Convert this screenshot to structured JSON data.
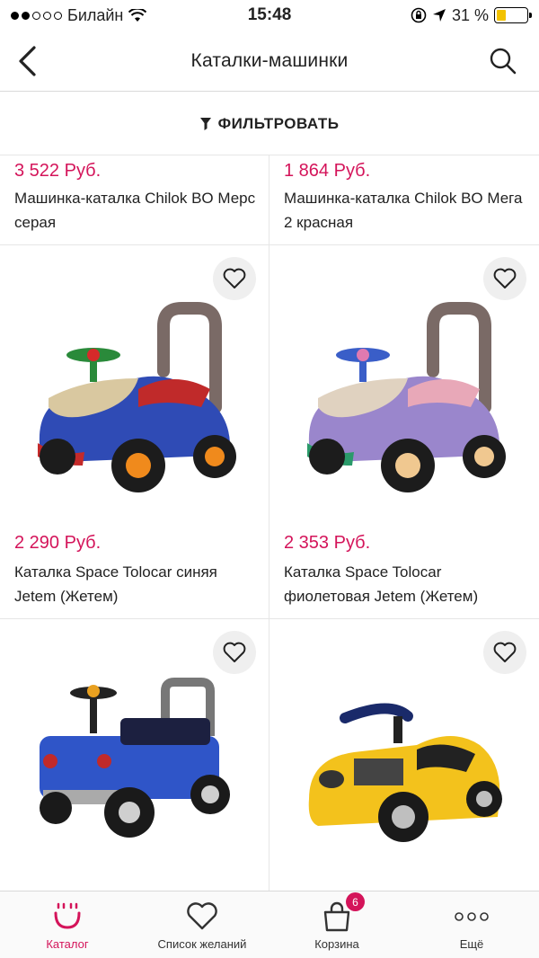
{
  "status_bar": {
    "carrier": "Билайн",
    "time": "15:48",
    "battery_percent": "31 %",
    "battery_level": 0.31
  },
  "nav": {
    "title": "Каталки-машинки",
    "back_icon": "chevron-left-icon",
    "search_icon": "search-icon"
  },
  "filter": {
    "label": "ФИЛЬТРОВАТЬ",
    "icon": "filter-funnel-icon"
  },
  "products": [
    {
      "price": "3 522 Руб.",
      "name": "Машинка-каталка Chilok BO Мерс серая"
    },
    {
      "price": "1 864 Руб.",
      "name": "Машинка-каталка Chilok BO Мега 2 красная"
    },
    {
      "price": "2 290 Руб.",
      "name": "Каталка Space Tolocar синяя Jetem (Жетем)",
      "image": "blue-ride-on-car-image"
    },
    {
      "price": "2 353 Руб.",
      "name": "Каталка Space Tolocar фиолетовая Jetem (Жетем)",
      "image": "purple-ride-on-car-image"
    },
    {
      "image": "blue-jeep-ride-on-image"
    },
    {
      "image": "yellow-sports-car-ride-on-image"
    }
  ],
  "tab_bar": {
    "items": [
      {
        "label": "Каталог",
        "icon": "catalog-smile-icon",
        "active": true
      },
      {
        "label": "Список желаний",
        "icon": "heart-icon"
      },
      {
        "label": "Корзина",
        "icon": "bag-icon",
        "badge": "6"
      },
      {
        "label": "Ещё",
        "icon": "more-dots-icon"
      }
    ]
  },
  "colors": {
    "accent": "#d4145a",
    "battery": "#f2c200"
  }
}
